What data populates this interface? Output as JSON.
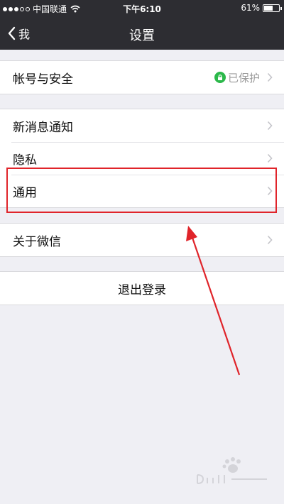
{
  "status_bar": {
    "carrier": "中国联通",
    "time": "下午6:10",
    "battery": "61%",
    "battery_level": 0.61,
    "signal_dots_filled": 3,
    "signal_dots_total": 5
  },
  "navbar": {
    "back_label": "我",
    "title": "设置"
  },
  "groups": [
    {
      "items": [
        {
          "label": "帐号与安全",
          "value": "已保护",
          "has_lock": true
        }
      ]
    },
    {
      "items": [
        {
          "label": "新消息通知"
        },
        {
          "label": "隐私"
        },
        {
          "label": "通用"
        }
      ]
    },
    {
      "items": [
        {
          "label": "关于微信"
        }
      ]
    }
  ],
  "logout_label": "退出登录",
  "colors": {
    "nav_bg": "#2d2d32",
    "page_bg": "#efeff4",
    "accent_green": "#2bb84a",
    "annotation_red": "#e0242a"
  },
  "annotation": {
    "highlighted_item": "通用"
  },
  "icons": [
    "wifi-icon",
    "battery-icon",
    "chevron-left-icon",
    "lock-icon",
    "chevron-right-icon"
  ]
}
